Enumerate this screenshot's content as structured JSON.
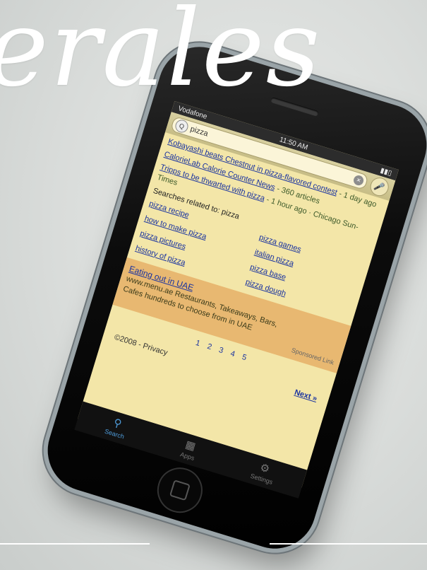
{
  "headline": "erales",
  "statusbar": {
    "carrier": "Vodafone",
    "time": "11:50 AM"
  },
  "search": {
    "query": "pizza"
  },
  "results": [
    {
      "title": "Kobayashi beats Chestnut in pizza-flavored contest",
      "meta": "- 1 day ago"
    },
    {
      "title": "CalorieLab Calorie Counter News",
      "meta": "- 360 articles"
    },
    {
      "title": "Tripps to be thwarted with pizza",
      "meta": "- 1 hour ago · Chicago Sun-Times"
    }
  ],
  "related_head": "Searches related to: pizza",
  "related": [
    "pizza recipe",
    "pizza games",
    "how to make pizza",
    "italian pizza",
    "pizza pictures",
    "pizza base",
    "history of pizza",
    "pizza dough"
  ],
  "ad": {
    "title": "Eating out in UAE",
    "line1": "www.menu.ae Restaurants, Takeaways, Bars,",
    "line2": "Cafes hundreds to choose from in UAE",
    "tag": "Sponsored Link"
  },
  "pager": [
    "1",
    "2",
    "3",
    "4",
    "5"
  ],
  "footer": {
    "copyright": "©2008 - Privacy",
    "next": "Next »"
  },
  "tabs": [
    {
      "label": "Search",
      "icon": "search-icon"
    },
    {
      "label": "Apps",
      "icon": "apps-icon"
    },
    {
      "label": "Settings",
      "icon": "gear-icon"
    }
  ],
  "colors": {
    "screen_bg": "#f3e6a8",
    "link": "#1a33a0",
    "ad_bg": "#e8b871",
    "active_tab": "#4e9bd9"
  }
}
